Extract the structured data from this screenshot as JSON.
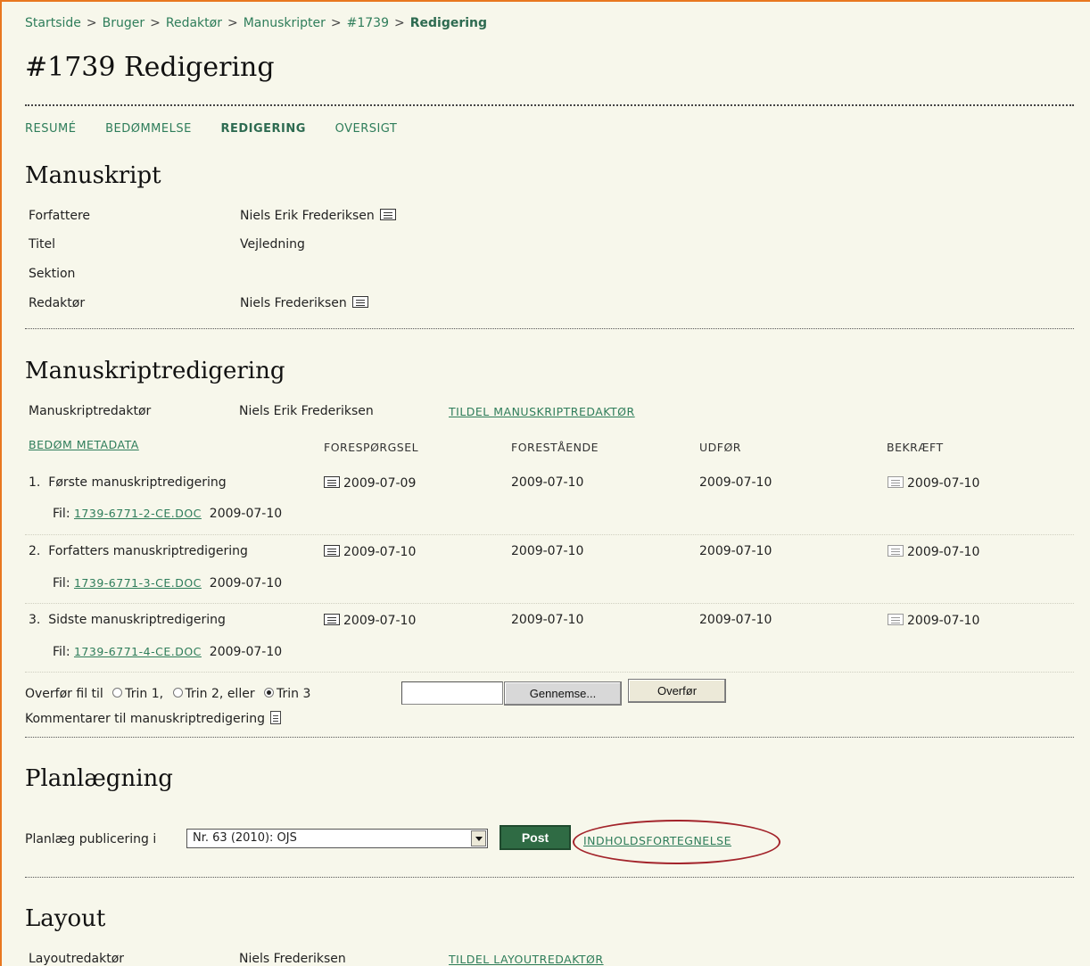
{
  "breadcrumbs": [
    "Startside",
    "Bruger",
    "Redaktør",
    "Manuskripter",
    "#1739"
  ],
  "breadcrumb_current": "Redigering",
  "breadcrumb_sep": ">",
  "page_title": "#1739 Redigering",
  "tabs": [
    {
      "label": "RESUMÉ",
      "active": false
    },
    {
      "label": "BEDØMMELSE",
      "active": false
    },
    {
      "label": "REDIGERING",
      "active": true
    },
    {
      "label": "OVERSIGT",
      "active": false
    }
  ],
  "manuskript": {
    "heading": "Manuskript",
    "rows": [
      {
        "label": "Forfattere",
        "value": "Niels Erik Frederiksen"
      },
      {
        "label": "Titel",
        "value": "Vejledning"
      },
      {
        "label": "Sektion",
        "value": ""
      },
      {
        "label": "Redaktør",
        "value": "Niels Frederiksen"
      }
    ]
  },
  "copyedit": {
    "heading": "Manuskriptredigering",
    "editor_label": "Manuskriptredaktør",
    "editor_name": "Niels Erik Frederiksen",
    "assign_link": "TILDEL MANUSKRIPTREDAKTØR",
    "metadata_link": "BEDØM METADATA",
    "columns": [
      "FORESPØRGSEL",
      "FORESTÅENDE",
      "UDFØR",
      "BEKRÆFT"
    ],
    "steps": [
      {
        "num": "1.",
        "name": "Første manuskriptredigering",
        "request": "2009-07-09",
        "underway": "2009-07-10",
        "complete": "2009-07-10",
        "acknowledge": "2009-07-10",
        "file_label": "Fil:",
        "file_link": "1739-6771-2-CE.DOC",
        "file_date": "2009-07-10"
      },
      {
        "num": "2.",
        "name": "Forfatters manuskriptredigering",
        "request": "2009-07-10",
        "underway": "2009-07-10",
        "complete": "2009-07-10",
        "acknowledge": "2009-07-10",
        "file_label": "Fil:",
        "file_link": "1739-6771-3-CE.DOC",
        "file_date": "2009-07-10"
      },
      {
        "num": "3.",
        "name": "Sidste manuskriptredigering",
        "request": "2009-07-10",
        "underway": "2009-07-10",
        "complete": "2009-07-10",
        "acknowledge": "2009-07-10",
        "file_label": "Fil:",
        "file_link": "1739-6771-4-CE.DOC",
        "file_date": "2009-07-10"
      }
    ],
    "upload": {
      "prefix": "Overfør fil til",
      "options": [
        "Trin 1,",
        "Trin 2, eller",
        "Trin 3"
      ],
      "selected_index": 2,
      "browse_label": "Gennemse...",
      "upload_label": "Overfør"
    },
    "comments_label": "Kommentarer til manuskriptredigering"
  },
  "scheduling": {
    "heading": "Planlægning",
    "label": "Planlæg publicering i",
    "selected_issue": "Nr. 63 (2010): OJS",
    "post_label": "Post",
    "toc_link": "INDHOLDSFORTEGNELSE",
    "highlight_color": "#a3242b"
  },
  "layout": {
    "heading": "Layout",
    "editor_label": "Layoutredaktør",
    "editor_name": "Niels Frederiksen",
    "assign_link": "TILDEL LAYOUTREDAKTØR"
  },
  "colors": {
    "accent": "#2e7d5a",
    "frame": "#e8771f",
    "background": "#f7f7eb"
  }
}
